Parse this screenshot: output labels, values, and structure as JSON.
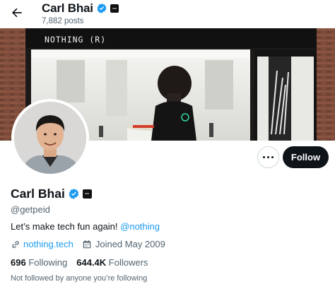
{
  "header": {
    "name": "Carl Bhai",
    "post_count": "7,882 posts"
  },
  "banner": {
    "store_sign": "NOTHING (R)"
  },
  "actions": {
    "follow_label": "Follow"
  },
  "profile": {
    "name": "Carl Bhai",
    "handle": "@getpeid",
    "bio_text": "Let’s make tech fun again! ",
    "bio_mention": "@nothing",
    "website": "nothing.tech",
    "joined": "Joined May 2009",
    "following_count": "696",
    "following_label": "Following",
    "followers_count": "644.4K",
    "followers_label": "Followers",
    "not_followed_note": "Not followed by anyone you’re following"
  },
  "colors": {
    "accent": "#1d9bf0",
    "text": "#0f1419",
    "secondary": "#536471",
    "button_dark": "#0f1419"
  },
  "icons": {
    "back": "arrow-left-icon",
    "verified": "verified-badge-icon",
    "affiliation": "affiliation-badge-icon",
    "link": "link-icon",
    "calendar": "calendar-icon",
    "more": "more-dots-icon"
  }
}
